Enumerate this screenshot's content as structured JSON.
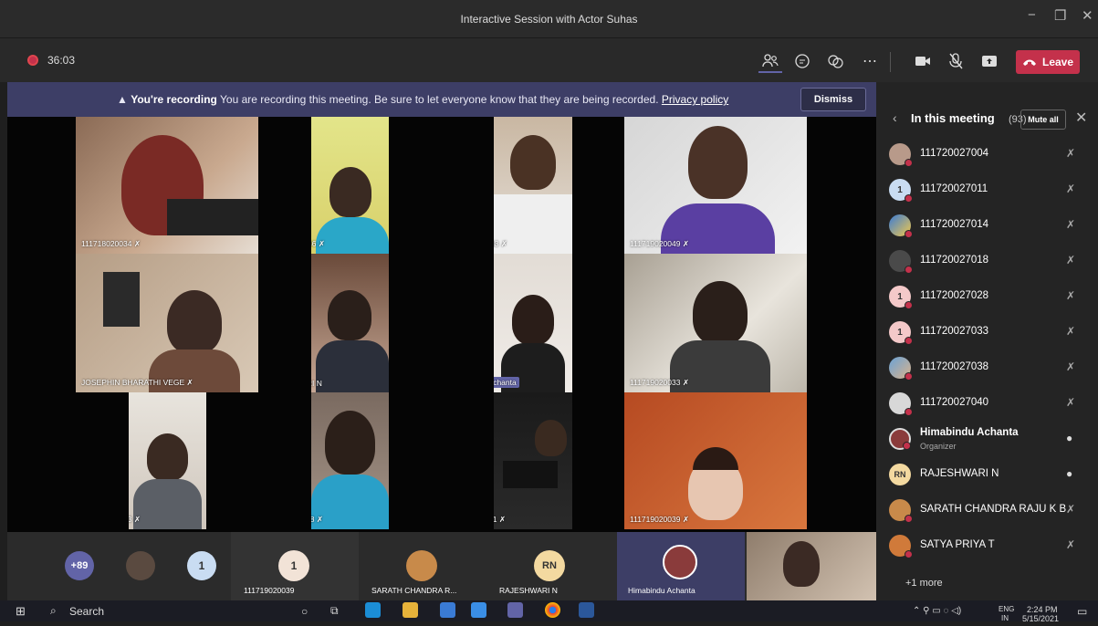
{
  "window": {
    "title": "Interactive Session with Actor Suhas",
    "min": "−",
    "max": "❐",
    "close": "✕"
  },
  "toolbar": {
    "timer": "36:03",
    "leave_label": "Leave"
  },
  "banner": {
    "bold": "You're recording",
    "text": "You are recording this meeting. Be sure to let everyone know that they are being recorded.",
    "link": "Privacy policy",
    "dismiss": "Dismiss"
  },
  "tiles": [
    {
      "label": "111718020034 ✗"
    },
    {
      "label": "111720020046 ✗"
    },
    {
      "label": "111720020043 ✗"
    },
    {
      "label": "111719020049 ✗"
    },
    {
      "label": "JOSEPHIN BHARATHI VEGE ✗"
    },
    {
      "label": "RAJESHWARI N"
    },
    {
      "label": "Himabindu Achanta"
    },
    {
      "label": "111719020033 ✗"
    },
    {
      "label": "111719020023 ✗"
    },
    {
      "label": "111720020038 ✗"
    },
    {
      "label": "111719020021 ✗"
    },
    {
      "label": "111719020039 ✗"
    }
  ],
  "panel": {
    "title": "In this meeting",
    "count": "(93)",
    "mute_all": "Mute all",
    "participants": [
      {
        "name": "111720027004",
        "initials": ""
      },
      {
        "name": "111720027011",
        "initials": "1"
      },
      {
        "name": "111720027014",
        "initials": ""
      },
      {
        "name": "111720027018",
        "initials": ""
      },
      {
        "name": "111720027028",
        "initials": "1"
      },
      {
        "name": "111720027033",
        "initials": "1"
      },
      {
        "name": "111720027038",
        "initials": ""
      },
      {
        "name": "111720027040",
        "initials": ""
      },
      {
        "name": "Himabindu Achanta",
        "initials": "",
        "role": "Organizer"
      },
      {
        "name": "RAJESHWARI N",
        "initials": "RN"
      },
      {
        "name": "SARATH CHANDRA RAJU K B",
        "initials": ""
      },
      {
        "name": "SATYA PRIYA T",
        "initials": ""
      }
    ],
    "more": "+1 more"
  },
  "strip": {
    "overflow": "+89",
    "one_a": "1",
    "one_b": "1",
    "rn": "RN",
    "labels": [
      "111719020039",
      "SARATH CHANDRA R...",
      "RAJESHWARI N",
      "Himabindu Achanta"
    ]
  },
  "taskbar": {
    "search": "Search",
    "lang": "ENG",
    "region": "IN",
    "time": "2:24 PM",
    "date": "5/15/2021"
  },
  "colors": {
    "accent": "#6264a7",
    "leave": "#c4314b",
    "banner": "#3d3e66"
  }
}
